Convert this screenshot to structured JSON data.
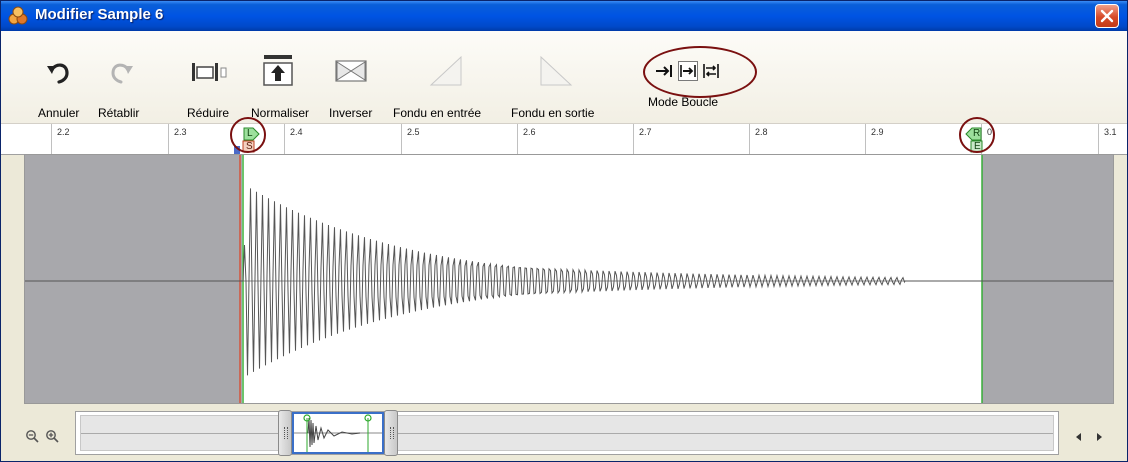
{
  "window": {
    "title": "Modifier Sample 6"
  },
  "toolbar": {
    "undo": "Annuler",
    "redo": "Rétablir",
    "trim": "Réduire",
    "normalize": "Normaliser",
    "reverse": "Inverser",
    "fade_in": "Fondu en entrée",
    "fade_out": "Fondu en sortie",
    "loop_mode": "Mode Boucle",
    "loop_mode_selected": "loop-forward"
  },
  "ruler": {
    "ticks": [
      "2.2",
      "2.3",
      "2.4",
      "2.5",
      "2.6",
      "2.7",
      "2.8",
      "2.9",
      "0",
      "3.1"
    ]
  },
  "markers": {
    "loop_start_upper": "L",
    "loop_start_lower": "S",
    "loop_end_upper": "R",
    "loop_end_lower": "E"
  },
  "colors": {
    "loop_marker": "#2eaa2e",
    "start_marker": "#e04020",
    "waveform": "#555555",
    "outside_region": "#a8a8ac",
    "highlight_circle": "#7a1010"
  }
}
